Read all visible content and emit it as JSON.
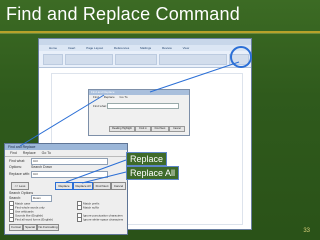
{
  "slide": {
    "title": "Find and Replace Command",
    "page_number": "33",
    "callouts": {
      "replace": "Replace",
      "replace_all": "Replace All"
    }
  },
  "word": {
    "menu": [
      "Home",
      "Insert",
      "Page Layout",
      "References",
      "Mailings",
      "Review",
      "View"
    ]
  },
  "small_dialog": {
    "title": "Find and Replace",
    "tabs": [
      "Find",
      "Replace",
      "Go To"
    ],
    "find_label": "Find what:",
    "buttons": [
      "Reading Highlight",
      "Find in",
      "Find Next",
      "Cancel"
    ]
  },
  "big_dialog": {
    "title": "Find and Replace",
    "tabs": [
      "Find",
      "Replace",
      "Go To"
    ],
    "find_label": "Find what:",
    "options_label": "Options:",
    "replace_label": "Replace with:",
    "find_value": "Ctrl",
    "options_value": "Search Down",
    "replace_value": "Ctrl",
    "buttons": {
      "less": "<< Less",
      "replace": "Replace",
      "replace_all": "Replace All",
      "find_next": "Find Next",
      "cancel": "Cancel"
    },
    "search_options_label": "Search Options",
    "search_label": "Search:",
    "search_value": "Down",
    "options_left": [
      "Match case",
      "Find whole words only",
      "Use wildcards",
      "Sounds like (English)",
      "Find all word forms (English)"
    ],
    "options_right": [
      "Match prefix",
      "Match suffix",
      "Ignore punctuation characters",
      "Ignore white-space characters"
    ],
    "bottom_buttons": [
      "Format",
      "Special",
      "No Formatting"
    ]
  },
  "colors": {
    "accent": "#2b6fd6",
    "background": "#2f5a1c",
    "title_rule": "#b7a12a"
  }
}
